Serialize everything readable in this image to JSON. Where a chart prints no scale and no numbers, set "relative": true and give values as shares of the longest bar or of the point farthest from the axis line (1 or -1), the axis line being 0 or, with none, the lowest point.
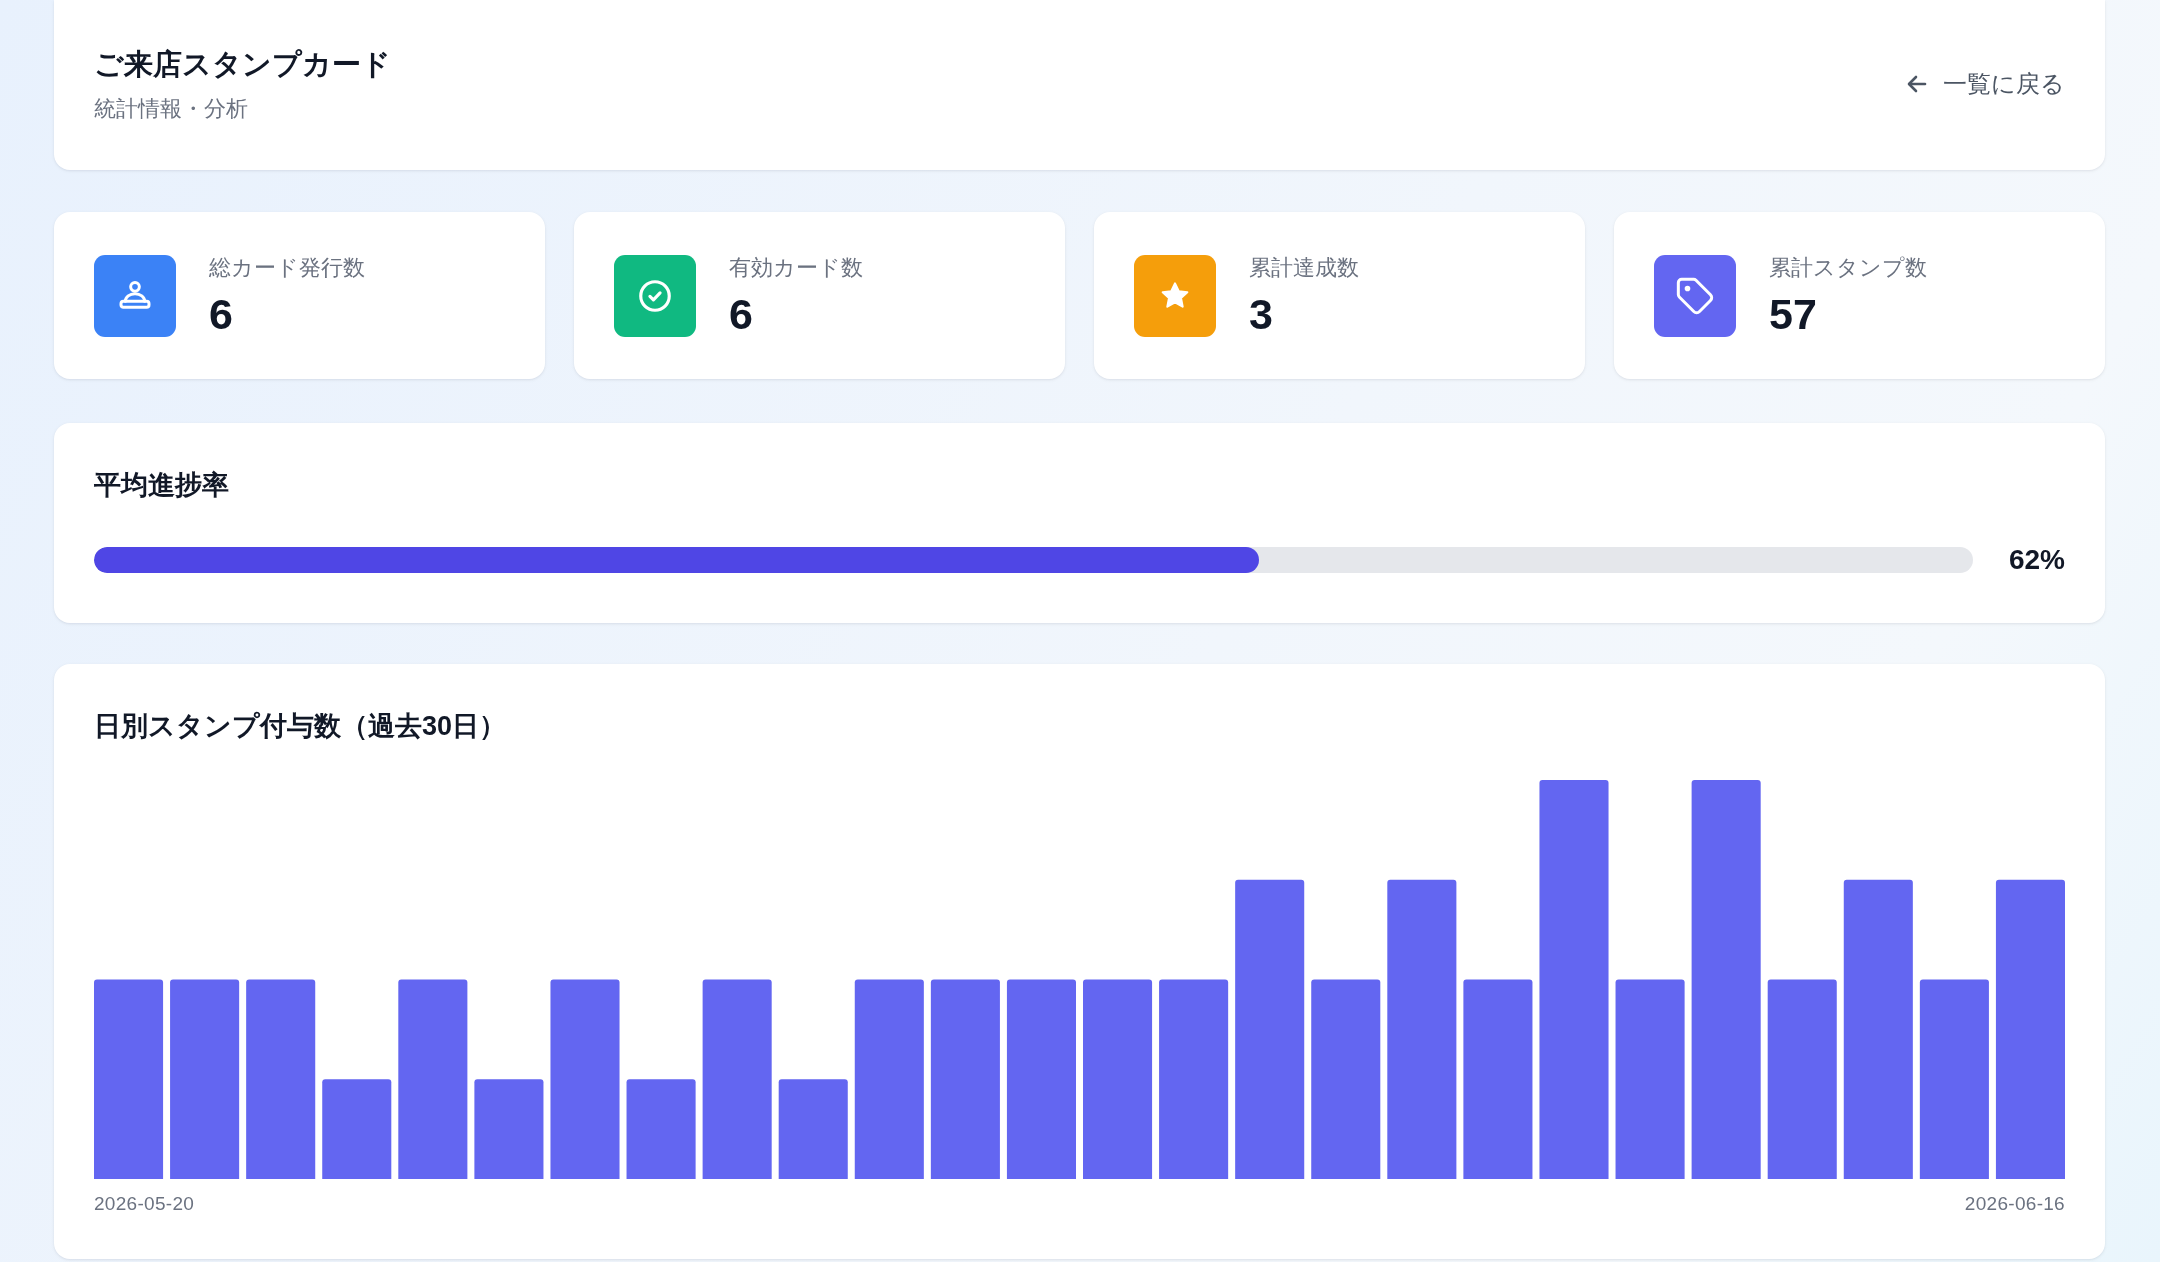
{
  "header": {
    "title": "ご来店スタンプカード",
    "subtitle": "統計情報・分析",
    "back_link": {
      "label": "一覧に戻る"
    }
  },
  "stats": [
    {
      "label": "総カード発行数",
      "value": "6",
      "color": "#3b82f6"
    },
    {
      "label": "有効カード数",
      "value": "6",
      "color": "#10b981"
    },
    {
      "label": "累計達成数",
      "value": "3",
      "color": "#f59e0b"
    },
    {
      "label": "累計スタンプ数",
      "value": "57",
      "color": "#6366f1"
    }
  ],
  "progress": {
    "title": "平均進捗率",
    "level": 0.62,
    "reading": "62%"
  },
  "daily_stamps": {
    "chart_data": {
      "type": "bar",
      "title": "日別スタンプ付与数（過去30日）",
      "relative": true,
      "categories": [
        "2026-05-20",
        null,
        null,
        null,
        null,
        null,
        null,
        null,
        null,
        null,
        null,
        null,
        null,
        null,
        null,
        null,
        null,
        null,
        null,
        null,
        null,
        null,
        null,
        null,
        null,
        "2026-06-16"
      ],
      "values": [
        0.5,
        0.5,
        0.5,
        0.25,
        0.5,
        0.25,
        0.5,
        0.25,
        0.5,
        0.25,
        0.5,
        0.5,
        0.5,
        0.5,
        0.5,
        0.75,
        0.5,
        0.75,
        0.5,
        1,
        0.5,
        1,
        0.5,
        0.75,
        0.5,
        0.75
      ]
    }
  }
}
